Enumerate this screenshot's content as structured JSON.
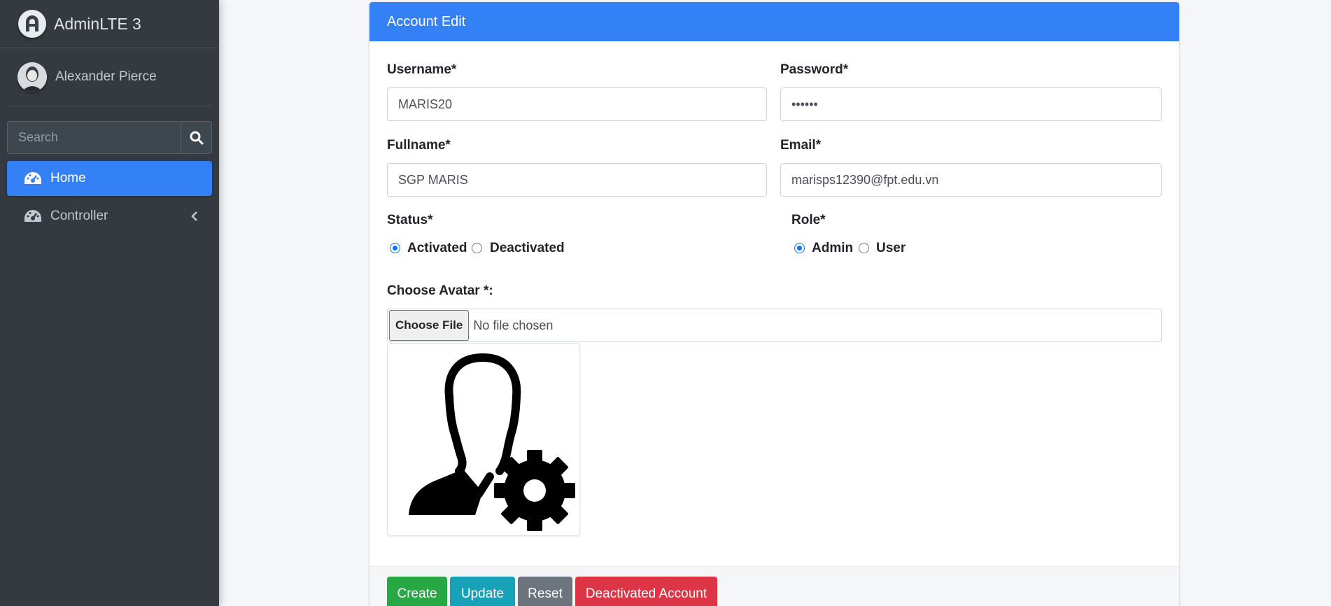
{
  "sidebar": {
    "brand": "AdminLTE 3",
    "user_name": "Alexander Pierce",
    "search_placeholder": "Search",
    "nav": [
      {
        "label": "Home",
        "icon": "tachometer-icon",
        "active": true
      },
      {
        "label": "Controller",
        "icon": "tachometer-icon",
        "active": false
      }
    ]
  },
  "card": {
    "title": "Account Edit",
    "username": {
      "label": "Username*",
      "value": "MARIS20"
    },
    "password": {
      "label": "Password*",
      "value": "••••••"
    },
    "fullname": {
      "label": "Fullname*",
      "value": "SGP MARIS"
    },
    "email": {
      "label": "Email*",
      "value": "marisps12390@fpt.edu.vn"
    },
    "status": {
      "label": "Status*",
      "options": [
        "Activated",
        "Deactivated"
      ],
      "selected": "Activated"
    },
    "role": {
      "label": "Role*",
      "options": [
        "Admin",
        "User"
      ],
      "selected": "Admin"
    },
    "avatar": {
      "label": "Choose Avatar *:",
      "button": "Choose File",
      "file_text": "No file chosen"
    },
    "buttons": {
      "create": "Create",
      "update": "Update",
      "reset": "Reset",
      "deactivate": "Deactivated Account"
    }
  },
  "colors": {
    "primary": "#3481f7",
    "success": "#28a745",
    "info": "#17a2b8",
    "secondary": "#6c757d",
    "danger": "#dc3545",
    "sidebar": "#343a40"
  }
}
